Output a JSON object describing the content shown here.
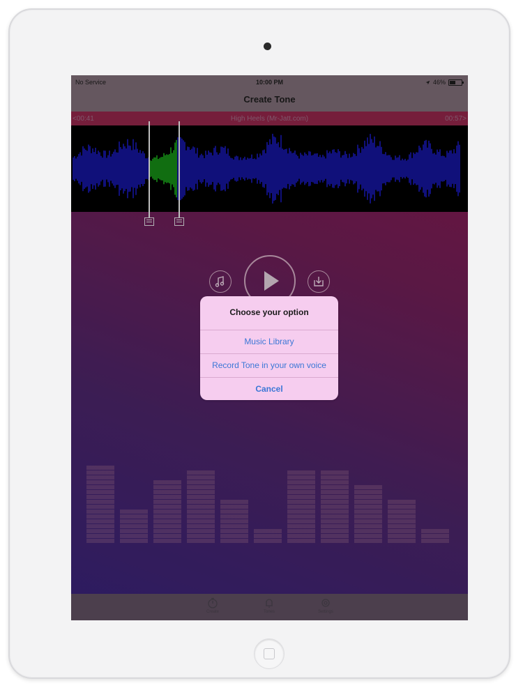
{
  "status_bar": {
    "carrier": "No Service",
    "time": "10:00 PM",
    "battery": "46%"
  },
  "nav": {
    "title": "Create Tone"
  },
  "track": {
    "start": "<00:41",
    "title": "High Heels (Mr-Jatt.com)",
    "end": "00:57>"
  },
  "controls": {
    "music_icon": "music-note-icon",
    "play_icon": "play-icon",
    "save_icon": "download-icon"
  },
  "alert": {
    "title": "Choose your option",
    "actions": [
      "Music Library",
      "Record Tone in your own voice",
      "Cancel"
    ]
  },
  "tabs": [
    {
      "icon": "stopwatch-icon",
      "label": "Create"
    },
    {
      "icon": "bell-icon",
      "label": "Tones"
    },
    {
      "icon": "gear-icon",
      "label": "Settings"
    }
  ],
  "colors": {
    "waveform": "#1c1cd6",
    "selection": "#1fc01f",
    "alert_bg": "#f6cdef",
    "alert_action": "#3b77d6"
  }
}
